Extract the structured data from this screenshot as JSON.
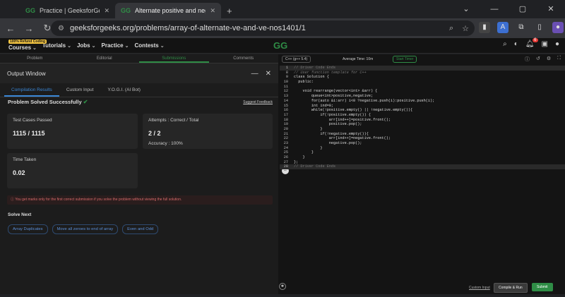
{
  "browser": {
    "tabs": [
      {
        "favicon": "GG",
        "title": "Practice | GeeksforGeeks | A co",
        "active": false
      },
      {
        "favicon": "GG",
        "title": "Alternate positive and negative",
        "active": true
      }
    ],
    "new_tab": "+",
    "window_controls": [
      "⌄",
      "—",
      "▢",
      "✕"
    ],
    "url": "geeksforgeeks.org/problems/array-of-alternate-ve-and-ve-nos1401/1"
  },
  "gfg_nav": {
    "hiring_badge": "100% Refund Coding",
    "items": [
      "Courses",
      "Tutorials",
      "Jobs",
      "Practice",
      "Contests"
    ],
    "logo": "GG",
    "notification_count": "6"
  },
  "problem_tabs": [
    "Problem",
    "Editorial",
    "Submissions",
    "Comments"
  ],
  "output_window": {
    "title": "Output Window",
    "result_tabs": [
      "Compilation Results",
      "Custom Input",
      "Y.O.G.I. (AI Bot)"
    ],
    "status": "Problem Solved Successfully",
    "suggest_feedback": "Suggest Feedback",
    "test_cases_label": "Test Cases Passed",
    "test_cases_value": "1115 / 1115",
    "attempts_label": "Attempts : Correct / Total",
    "attempts_value": "2 / 2",
    "accuracy": "Accuracy : 100%",
    "time_label": "Time Taken",
    "time_value": "0.02",
    "note": "You get marks only for the first correct submission if you solve the problem without viewing the full solution.",
    "solve_next": "Solve Next",
    "next_problems": [
      "Array Duplicates",
      "Move all zeroes to end of array",
      "Even and Odd"
    ]
  },
  "editor": {
    "language": "C++ (g++ 5.4)",
    "avg_time": "Average Time: 10m",
    "timer": "Start Timer",
    "lines": [
      {
        "n": "1",
        "code": "// Driver Code Ends",
        "fold": true
      },
      {
        "n": "8",
        "code": "// User function template for C++",
        "comment": true
      },
      {
        "n": "9",
        "code": "class Solution {"
      },
      {
        "n": "10",
        "code": "  public:"
      },
      {
        "n": "11",
        "code": ""
      },
      {
        "n": "12",
        "code": "    void rearrange(vector<int> &arr) {"
      },
      {
        "n": "13",
        "code": "        queue<int>positive,negative;"
      },
      {
        "n": "14",
        "code": "        for(auto &i:arr) i<0 ?negative.push(i):positive.push(i);"
      },
      {
        "n": "15",
        "code": "        int ind=0;"
      },
      {
        "n": "16",
        "code": "        while(!positive.empty() || !negative.empty()){"
      },
      {
        "n": "17",
        "code": "            if(!positive.empty()) {"
      },
      {
        "n": "18",
        "code": "                arr[ind++]=positive.front();"
      },
      {
        "n": "19",
        "code": "                positive.pop();"
      },
      {
        "n": "20",
        "code": "            }"
      },
      {
        "n": "21",
        "code": "            if(!negative.empty()){"
      },
      {
        "n": "22",
        "code": "                arr[ind++]=negative.front();"
      },
      {
        "n": "23",
        "code": "                negative.pop();"
      },
      {
        "n": "24",
        "code": "            }"
      },
      {
        "n": "25",
        "code": "        }"
      },
      {
        "n": "26",
        "code": "    }"
      },
      {
        "n": "27",
        "code": "};"
      },
      {
        "n": "28",
        "code": "// Driver Code Ends",
        "fold": true
      }
    ],
    "custom_input": "Custom Input",
    "compile_run": "Compile & Run",
    "submit": "Submit"
  }
}
